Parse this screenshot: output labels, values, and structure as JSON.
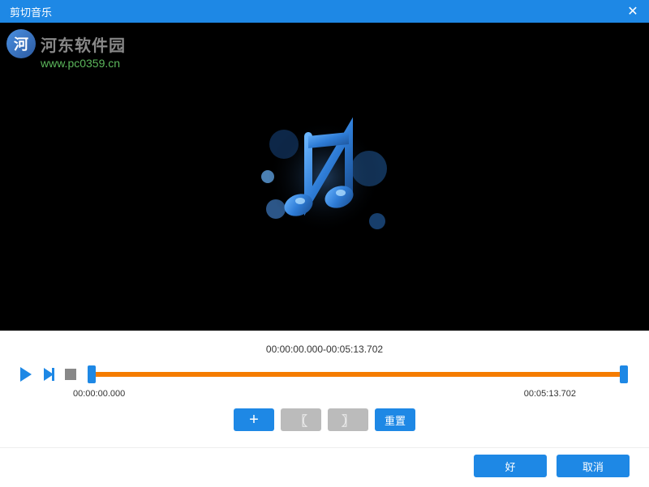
{
  "window": {
    "title": "剪切音乐"
  },
  "watermark": {
    "text": "河东软件园",
    "url": "www.pc0359.cn"
  },
  "timeline": {
    "range_display": "00:00:00.000-00:05:13.702",
    "start_time": "00:00:00.000",
    "end_time": "00:05:13.702"
  },
  "buttons": {
    "reset": "重置",
    "ok": "好",
    "cancel": "取消"
  },
  "colors": {
    "accent": "#1e88e5",
    "track": "#f57c00"
  }
}
